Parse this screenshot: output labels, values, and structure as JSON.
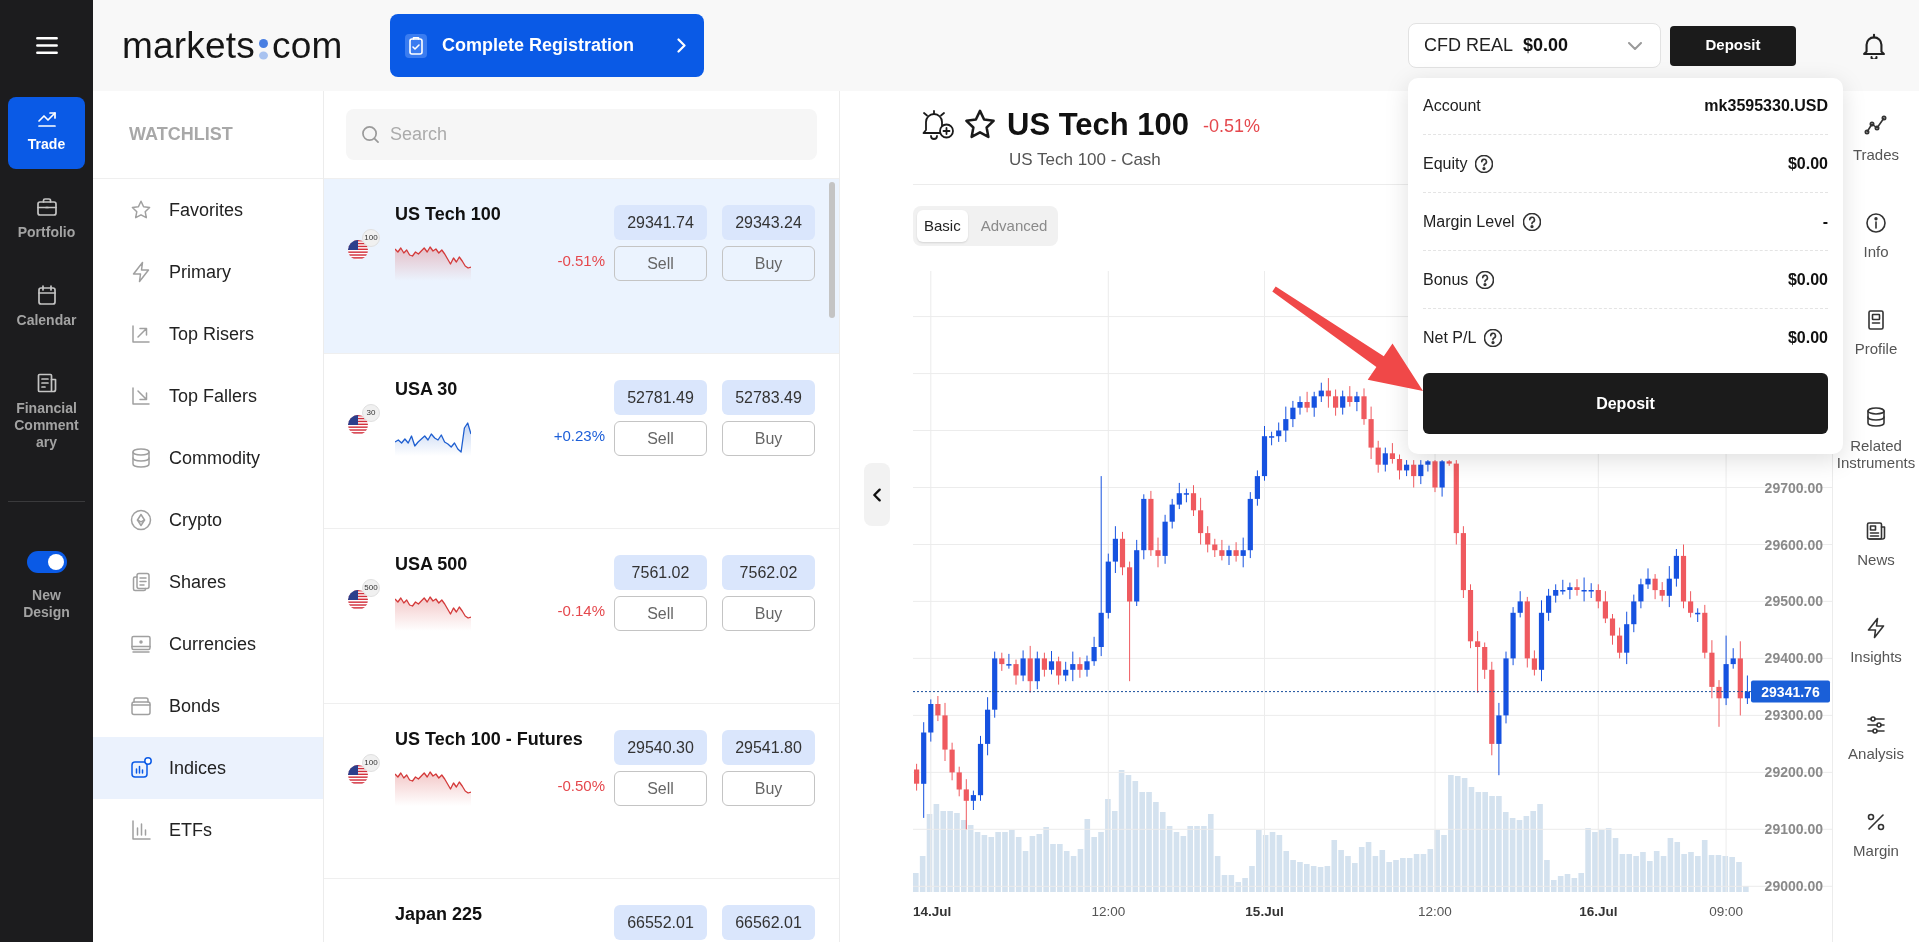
{
  "nav": {
    "items": [
      {
        "label": "Trade",
        "selected": true
      },
      {
        "label": "Portfolio",
        "selected": false
      },
      {
        "label": "Calendar",
        "selected": false
      },
      {
        "label": "Financial Commentary",
        "selected": false
      }
    ],
    "toggle": {
      "label": "New Design",
      "on": true
    }
  },
  "header": {
    "logo": {
      "left": "markets",
      "right": "com"
    },
    "registration_button": "Complete Registration",
    "account_selector": {
      "account_type": "CFD REAL",
      "balance": "$0.00"
    },
    "deposit_button": "Deposit"
  },
  "watchlist": {
    "title": "WATCHLIST",
    "items": [
      {
        "label": "Favorites",
        "selected": false
      },
      {
        "label": "Primary",
        "selected": false
      },
      {
        "label": "Top Risers",
        "selected": false
      },
      {
        "label": "Top Fallers",
        "selected": false
      },
      {
        "label": "Commodity",
        "selected": false
      },
      {
        "label": "Crypto",
        "selected": false
      },
      {
        "label": "Shares",
        "selected": false
      },
      {
        "label": "Currencies",
        "selected": false
      },
      {
        "label": "Bonds",
        "selected": false
      },
      {
        "label": "Indices",
        "selected": true
      },
      {
        "label": "ETFs",
        "selected": false
      }
    ]
  },
  "instruments": {
    "search": {
      "placeholder": "Search"
    },
    "rows": [
      {
        "name": "US Tech 100",
        "badge": "100",
        "change": "-0.51%",
        "falling": true,
        "bid": "29341.74",
        "ask": "29343.24",
        "sell": "Sell",
        "buy": "Buy",
        "selected": true
      },
      {
        "name": "USA 30",
        "badge": "30",
        "change": "+0.23%",
        "falling": false,
        "bid": "52781.49",
        "ask": "52783.49",
        "sell": "Sell",
        "buy": "Buy",
        "selected": false
      },
      {
        "name": "USA 500",
        "badge": "500",
        "change": "-0.14%",
        "falling": true,
        "bid": "7561.02",
        "ask": "7562.02",
        "sell": "Sell",
        "buy": "Buy",
        "selected": false
      },
      {
        "name": "US Tech 100 - Futures",
        "badge": "100",
        "change": "-0.50%",
        "falling": true,
        "bid": "29540.30",
        "ask": "29541.80",
        "sell": "Sell",
        "buy": "Buy",
        "selected": false
      },
      {
        "name": "Japan 225",
        "bid": "66552.01",
        "ask": "66562.01",
        "selected": false
      }
    ]
  },
  "instrument": {
    "title": "US Tech 100",
    "change": "-0.51%",
    "falling": true,
    "subtitle": "US Tech 100 - Cash",
    "chart_modes": [
      {
        "label": "Basic",
        "selected": true
      },
      {
        "label": "Advanced",
        "selected": false
      }
    ]
  },
  "chart": {
    "chart_data": {
      "type": "candlestick",
      "grid": true,
      "categories": [
        null,
        null,
        "14.Jul",
        null,
        null,
        null,
        null,
        null,
        null,
        null,
        null,
        null,
        null,
        null,
        null,
        null,
        null,
        null,
        null,
        null,
        null,
        null,
        null,
        null,
        null,
        null,
        null,
        "12:00",
        null,
        null,
        null,
        null,
        null,
        null,
        null,
        null,
        null,
        null,
        null,
        null,
        null,
        null,
        null,
        null,
        null,
        null,
        null,
        null,
        null,
        "15.Jul",
        null,
        null,
        null,
        null,
        null,
        null,
        null,
        null,
        null,
        null,
        null,
        null,
        null,
        null,
        null,
        null,
        null,
        null,
        null,
        null,
        null,
        null,
        null,
        "12:00",
        null,
        null,
        null,
        null,
        null,
        null,
        null,
        null,
        null,
        null,
        null,
        null,
        null,
        null,
        null,
        null,
        null,
        null,
        null,
        null,
        null,
        null,
        "16.Jul",
        null,
        null,
        null,
        null,
        null,
        null,
        null,
        null,
        null,
        null,
        null,
        null,
        null,
        null,
        null,
        null,
        null,
        "09:00",
        null,
        null,
        null
      ],
      "ohlc": [
        [
          29205,
          29215,
          29168,
          29180
        ],
        [
          29180,
          29288,
          29120,
          29270
        ],
        [
          29270,
          29328,
          29254,
          29320
        ],
        [
          29320,
          29334,
          29290,
          29300
        ],
        [
          29300,
          29322,
          29220,
          29240
        ],
        [
          29240,
          29252,
          29186,
          29200
        ],
        [
          29200,
          29210,
          29158,
          29170
        ],
        [
          29170,
          29188,
          29100,
          29150
        ],
        [
          29150,
          29168,
          29134,
          29160
        ],
        [
          29160,
          29264,
          29150,
          29250
        ],
        [
          29250,
          29332,
          29230,
          29310
        ],
        [
          29310,
          29412,
          29296,
          29400
        ],
        [
          29400,
          29410,
          29378,
          29390
        ],
        [
          29390,
          29408,
          29382,
          29390
        ],
        [
          29390,
          29398,
          29354,
          29370
        ],
        [
          29370,
          29414,
          29360,
          29400
        ],
        [
          29400,
          29422,
          29340,
          29360
        ],
        [
          29360,
          29412,
          29346,
          29400
        ],
        [
          29400,
          29410,
          29368,
          29380
        ],
        [
          29380,
          29413,
          29372,
          29395
        ],
        [
          29395,
          29403,
          29354,
          29370
        ],
        [
          29370,
          29394,
          29360,
          29380
        ],
        [
          29380,
          29412,
          29360,
          29390
        ],
        [
          29390,
          29402,
          29366,
          29380
        ],
        [
          29380,
          29405,
          29368,
          29395
        ],
        [
          29395,
          29438,
          29387,
          29420
        ],
        [
          29420,
          29720,
          29404,
          29480
        ],
        [
          29480,
          29584,
          29470,
          29570
        ],
        [
          29570,
          29632,
          29550,
          29610
        ],
        [
          29610,
          29622,
          29546,
          29560
        ],
        [
          29560,
          29570,
          29360,
          29500
        ],
        [
          29500,
          29608,
          29492,
          29590
        ],
        [
          29590,
          29688,
          29574,
          29680
        ],
        [
          29680,
          29694,
          29580,
          29590
        ],
        [
          29590,
          29612,
          29560,
          29580
        ],
        [
          29580,
          29652,
          29566,
          29640
        ],
        [
          29640,
          29680,
          29628,
          29670
        ],
        [
          29670,
          29708,
          29662,
          29690
        ],
        [
          29690,
          29698,
          29674,
          29690
        ],
        [
          29690,
          29704,
          29650,
          29660
        ],
        [
          29660,
          29682,
          29600,
          29620
        ],
        [
          29620,
          29632,
          29586,
          29600
        ],
        [
          29600,
          29610,
          29578,
          29590
        ],
        [
          29590,
          29608,
          29572,
          29580
        ],
        [
          29580,
          29598,
          29564,
          29590
        ],
        [
          29590,
          29604,
          29570,
          29580
        ],
        [
          29580,
          29612,
          29560,
          29590
        ],
        [
          29590,
          29692,
          29576,
          29680
        ],
        [
          29680,
          29730,
          29668,
          29720
        ],
        [
          29720,
          29808,
          29712,
          29790
        ],
        [
          29790,
          29798,
          29774,
          29790
        ],
        [
          29790,
          29814,
          29780,
          29800
        ],
        [
          29800,
          29842,
          29780,
          29820
        ],
        [
          29820,
          29852,
          29806,
          29840
        ],
        [
          29840,
          29860,
          29828,
          29850
        ],
        [
          29850,
          29868,
          29832,
          29840
        ],
        [
          29840,
          29868,
          29824,
          29860
        ],
        [
          29860,
          29884,
          29850,
          29870
        ],
        [
          29870,
          29892,
          29840,
          29860
        ],
        [
          29860,
          29872,
          29826,
          29840
        ],
        [
          29840,
          29870,
          29828,
          29860
        ],
        [
          29860,
          29878,
          29842,
          29850
        ],
        [
          29850,
          29868,
          29834,
          29860
        ],
        [
          29860,
          29874,
          29810,
          29820
        ],
        [
          29820,
          29842,
          29750,
          29770
        ],
        [
          29770,
          29782,
          29726,
          29740
        ],
        [
          29740,
          29770,
          29728,
          29760
        ],
        [
          29760,
          29778,
          29742,
          29750
        ],
        [
          29750,
          29758,
          29714,
          29730
        ],
        [
          29730,
          29748,
          29720,
          29740
        ],
        [
          29740,
          29748,
          29700,
          29720
        ],
        [
          29720,
          29748,
          29706,
          29740
        ],
        [
          29740,
          29748,
          29728,
          29746
        ],
        [
          29746,
          29748,
          29692,
          29700
        ],
        [
          29700,
          29748,
          29684,
          29746
        ],
        [
          29746,
          29748,
          29738,
          29742
        ],
        [
          29742,
          29748,
          29600,
          29620
        ],
        [
          29620,
          29632,
          29506,
          29520
        ],
        [
          29520,
          29530,
          29418,
          29430
        ],
        [
          29430,
          29448,
          29340,
          29420
        ],
        [
          29420,
          29428,
          29364,
          29380
        ],
        [
          29380,
          29394,
          29230,
          29250
        ],
        [
          29250,
          29322,
          29195,
          29300
        ],
        [
          29300,
          29412,
          29286,
          29400
        ],
        [
          29400,
          29490,
          29388,
          29480
        ],
        [
          29480,
          29518,
          29472,
          29500
        ],
        [
          29500,
          29508,
          29384,
          29400
        ],
        [
          29400,
          29414,
          29370,
          29380
        ],
        [
          29380,
          29502,
          29360,
          29480
        ],
        [
          29480,
          29522,
          29466,
          29510
        ],
        [
          29510,
          29530,
          29498,
          29520
        ],
        [
          29520,
          29538,
          29512,
          29520
        ],
        [
          29520,
          29533,
          29504,
          29525
        ],
        [
          29525,
          29539,
          29510,
          29520
        ],
        [
          29520,
          29542,
          29500,
          29520
        ],
        [
          29520,
          29532,
          29506,
          29520
        ],
        [
          29520,
          29530,
          29488,
          29500
        ],
        [
          29500,
          29518,
          29462,
          29470
        ],
        [
          29470,
          29478,
          29424,
          29440
        ],
        [
          29440,
          29454,
          29400,
          29410
        ],
        [
          29410,
          29482,
          29390,
          29460
        ],
        [
          29460,
          29512,
          29446,
          29500
        ],
        [
          29500,
          29540,
          29488,
          29530
        ],
        [
          29530,
          29558,
          29522,
          29540
        ],
        [
          29540,
          29548,
          29504,
          29520
        ],
        [
          29520,
          29534,
          29500,
          29510
        ],
        [
          29510,
          29562,
          29490,
          29540
        ],
        [
          29540,
          29592,
          29526,
          29580
        ],
        [
          29580,
          29600,
          29488,
          29500
        ],
        [
          29500,
          29518,
          29472,
          29480
        ],
        [
          29480,
          29488,
          29464,
          29480
        ],
        [
          29480,
          29494,
          29400,
          29410
        ],
        [
          29410,
          29432,
          29330,
          29350
        ],
        [
          29350,
          29362,
          29280,
          29330
        ],
        [
          29330,
          29440,
          29318,
          29390
        ],
        [
          29390,
          29418,
          29382,
          29400
        ],
        [
          29400,
          29430,
          29300,
          29330
        ],
        [
          29330,
          29370,
          29320,
          29341.76
        ]
      ],
      "ylim": [
        28990,
        30080
      ],
      "yticks": [
        {
          "value": 29700,
          "label": "29700.00"
        },
        {
          "value": 29600,
          "label": "29600.00"
        },
        {
          "value": 29500,
          "label": "29500.00"
        },
        {
          "value": 29400,
          "label": "29400.00"
        },
        {
          "value": 29300,
          "label": "29300.00"
        },
        {
          "value": 29200,
          "label": "29200.00"
        },
        {
          "value": 29100,
          "label": "29100.00"
        },
        {
          "value": 29000,
          "label": "29000.00"
        }
      ],
      "ref_lines": [
        {
          "axis": "y",
          "value": 29341.76,
          "label": "29341.76"
        }
      ]
    }
  },
  "side_panel": {
    "items": [
      {
        "label": "Trades"
      },
      {
        "label": "Info"
      },
      {
        "label": "Profile"
      },
      {
        "label": "Related Instruments"
      },
      {
        "label": "News"
      },
      {
        "label": "Insights"
      },
      {
        "label": "Analysis"
      },
      {
        "label": "Margin"
      }
    ]
  },
  "account_panel": {
    "rows": [
      {
        "label": "Account",
        "value": "mk3595330.USD",
        "help_icon": false
      },
      {
        "label": "Equity",
        "value": "$0.00",
        "help_icon": true
      },
      {
        "label": "Margin Level",
        "value": "-",
        "help_icon": true
      },
      {
        "label": "Bonus",
        "value": "$0.00",
        "help_icon": true
      },
      {
        "label": "Net P/L",
        "value": "$0.00",
        "help_icon": true
      }
    ],
    "deposit_button": "Deposit"
  }
}
